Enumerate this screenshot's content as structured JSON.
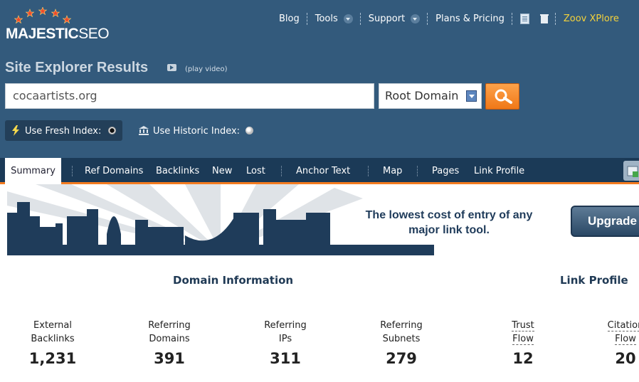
{
  "header": {
    "logo": {
      "brand": "MAJESTIC",
      "suffix": "SEO"
    },
    "nav": {
      "blog": "Blog",
      "tools": "Tools",
      "support": "Support",
      "plans": "Plans & Pricing",
      "user": "Zoov XPlore"
    },
    "icons": [
      "majestic-stars-icon",
      "document-icon",
      "trash-icon",
      "dropdown-chevron-icon"
    ]
  },
  "page": {
    "title": "Site Explorer Results",
    "video_link": "(play video)"
  },
  "search": {
    "value": "cocaartists.org",
    "scope": "Root Domain"
  },
  "index": {
    "fresh_label": "Use Fresh Index:",
    "historic_label": "Use Historic Index:",
    "selected": "fresh"
  },
  "tabs": {
    "summary": "Summary",
    "ref_domains": "Ref Domains",
    "backlinks": "Backlinks",
    "new": "New",
    "lost": "Lost",
    "anchor_text": "Anchor Text",
    "map": "Map",
    "pages": "Pages",
    "link_profile": "Link Profile"
  },
  "banner": {
    "line1": "The lowest cost of entry of any",
    "line2": "major link tool.",
    "upgrade": "Upgrade"
  },
  "sections": {
    "domain_info": "Domain Information",
    "link_profile": "Link Profile"
  },
  "stats": {
    "external_backlinks": {
      "l1": "External",
      "l2": "Backlinks",
      "value": "1,231"
    },
    "referring_domains": {
      "l1": "Referring",
      "l2": "Domains",
      "value": "391"
    },
    "referring_ips": {
      "l1": "Referring",
      "l2": "IPs",
      "value": "311"
    },
    "referring_subnets": {
      "l1": "Referring",
      "l2": "Subnets",
      "value": "279"
    },
    "trust_flow": {
      "l1": "Trust",
      "l2": "Flow",
      "value": "12"
    },
    "citation_flow": {
      "l1": "Citation",
      "l2": "Flow",
      "value": "20"
    }
  },
  "colors": {
    "header_bg": "#335a7c",
    "tabbar_bg": "#1b3a57",
    "accent_orange": "#f47b20",
    "user_yellow": "#f4d23b"
  }
}
